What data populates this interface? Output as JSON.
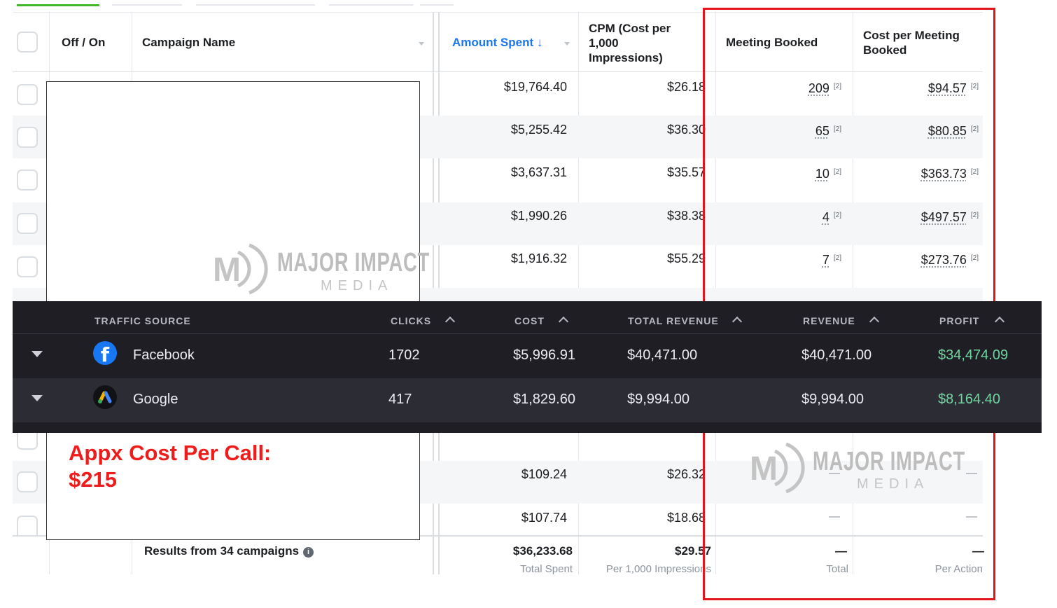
{
  "campaign_table": {
    "headers": {
      "toggle": "Off / On",
      "name": "Campaign Name",
      "amount_spent": "Amount Spent ↓",
      "cpm": [
        "CPM (Cost per",
        "1,000",
        "Impressions)"
      ],
      "meeting": "Meeting Booked",
      "cost_per_meeting": [
        "Cost per Meeting",
        "Booked"
      ]
    },
    "rows": [
      {
        "spent": "$19,764.40",
        "cpm": "$26.18",
        "meetings": "209",
        "cost": "$94.57",
        "ref": "[2]"
      },
      {
        "spent": "$5,255.42",
        "cpm": "$36.30",
        "meetings": "65",
        "cost": "$80.85",
        "ref": "[2]"
      },
      {
        "spent": "$3,637.31",
        "cpm": "$35.57",
        "meetings": "10",
        "cost": "$363.73",
        "ref": "[2]"
      },
      {
        "spent": "$1,990.26",
        "cpm": "$38.38",
        "meetings": "4",
        "cost": "$497.57",
        "ref": "[2]"
      },
      {
        "spent": "$1,916.32",
        "cpm": "$55.29",
        "meetings": "7",
        "cost": "$273.76",
        "ref": "[2]"
      }
    ],
    "lower_rows": [
      {
        "spent": "$109.24",
        "cpm": "$26.32",
        "meetings": "—",
        "cost": "—"
      },
      {
        "spent": "$107.74",
        "cpm": "$18.68",
        "meetings": "—",
        "cost": "—"
      }
    ],
    "footer": {
      "results": "Results from 34 campaigns",
      "info_icon": "info-icon",
      "total_spent": "$36,233.68",
      "total_spent_label": "Total Spent",
      "cpm": "$29.57",
      "cpm_label": "Per 1,000 Impressions",
      "meetings": "—",
      "meetings_label": "Total",
      "cost": "—",
      "cost_label": "Per Action"
    }
  },
  "watermark": {
    "logo_letter": "M",
    "title": "MAJOR IMPACT",
    "subtitle": "MEDIA"
  },
  "annotation": {
    "line1": "Appx Cost Per Call:",
    "line2": "$215",
    "color": "#ef1c1c"
  },
  "highlight_color": "#e3151a",
  "traffic_panel": {
    "headers": {
      "source": "TRAFFIC SOURCE",
      "clicks": "CLICKS",
      "cost": "COST",
      "total_revenue": "TOTAL REVENUE",
      "revenue": "REVENUE",
      "profit": "PROFIT"
    },
    "rows": [
      {
        "icon": "facebook-icon",
        "source": "Facebook",
        "clicks": "1702",
        "cost": "$5,996.91",
        "total_revenue": "$40,471.00",
        "revenue": "$40,471.00",
        "profit": "$34,474.09"
      },
      {
        "icon": "google-ads-icon",
        "source": "Google",
        "clicks": "417",
        "cost": "$1,829.60",
        "total_revenue": "$9,994.00",
        "revenue": "$9,994.00",
        "profit": "$8,164.40"
      }
    ],
    "profit_color": "#6fd6a0"
  }
}
